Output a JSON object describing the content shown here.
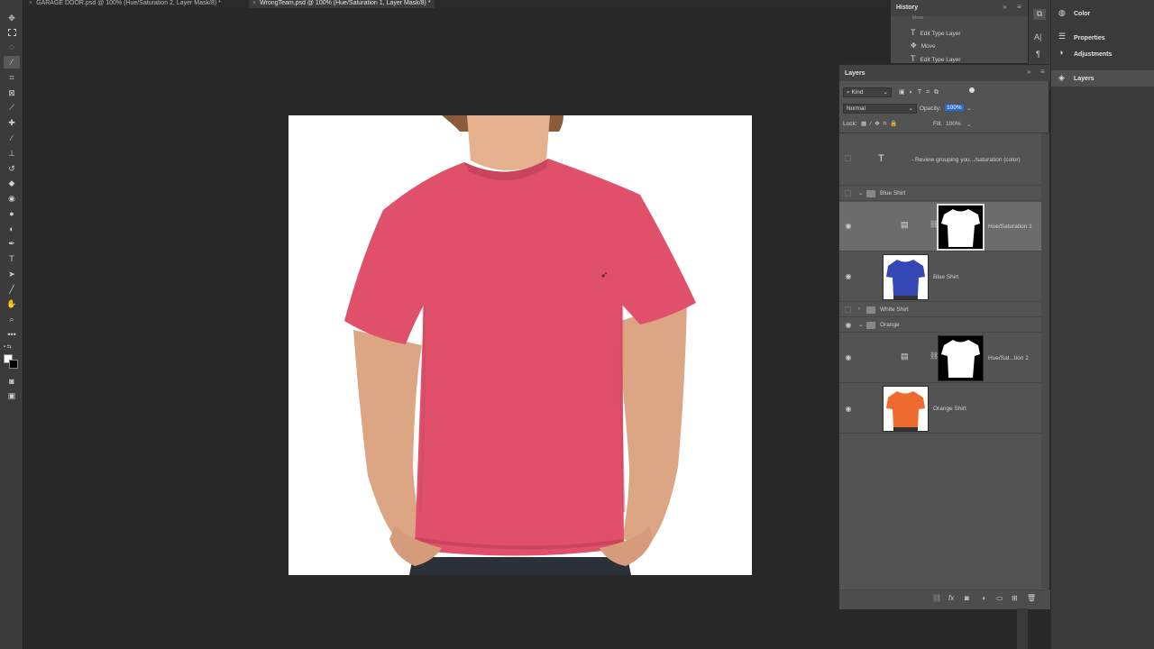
{
  "tabs": [
    {
      "label": "GARAGE DOOR.psd @ 100% (Hue/Saturation 2, Layer Mask/8) *",
      "active": false
    },
    {
      "label": "WrongTeam.psd @ 100% (Hue/Saturation 1, Layer Mask/8) *",
      "active": true
    }
  ],
  "history": {
    "title": "History",
    "items": [
      {
        "label": "Move",
        "icon": "move-icon"
      },
      {
        "label": "Edit Type Layer",
        "icon": "type-icon"
      },
      {
        "label": "Move",
        "icon": "move-icon"
      },
      {
        "label": "Edit Type Layer",
        "icon": "type-icon"
      }
    ]
  },
  "right_dock": {
    "color": "Color",
    "properties": "Properties",
    "adjustments": "Adjustments",
    "layers": "Layers"
  },
  "layers": {
    "title": "Layers",
    "filter_kind": "Kind",
    "blend_mode": "Normal",
    "opacity_label": "Opacity:",
    "opacity_value": "100%",
    "lock_label": "Lock:",
    "fill_label": "Fill:",
    "fill_value": "100%",
    "rows": {
      "text_layer": "- Review grouping you.../saturation (color)",
      "blue_group": "Blue Shirt",
      "hue1": "Hue/Saturation 1",
      "blue_shirt": "Blue Shirt",
      "white_group": "White Shirt",
      "orange_group": "Orange",
      "hue2": "Hue/Sat...tion 2",
      "orange_shirt": "Orange Shirt"
    }
  },
  "colors": {
    "shirt": "#e0506a",
    "blue_shirt": "#3348b4",
    "orange_shirt": "#ee6b30",
    "selection_highlight": "#2d6bd4"
  }
}
